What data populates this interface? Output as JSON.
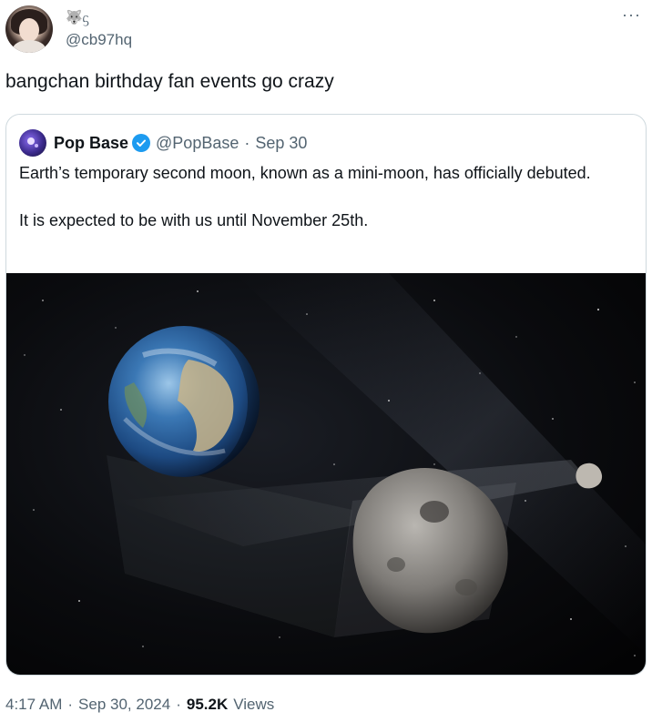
{
  "author": {
    "display_name_glyphs": "🐺ᦓ",
    "handle": "@cb97hq",
    "avatar_icon": "profile-photo",
    "more_label": "···"
  },
  "tweet": {
    "text": "bangchan birthday fan events go crazy"
  },
  "quote": {
    "name": "Pop Base",
    "handle": "@PopBase",
    "separator": "·",
    "date": "Sep 30",
    "paragraphs": [
      "Earth’s temporary second moon, known as a mini-moon, has officially debuted.",
      "It is expected to be with us until November 25th."
    ],
    "image_icon": "space-earth-asteroid-image",
    "verified_color": "#1d9bf0"
  },
  "footer": {
    "time": "4:17 AM",
    "sep1": "·",
    "date": "Sep 30, 2024",
    "sep2": "·",
    "views_count": "95.2K",
    "views_label": "Views"
  }
}
